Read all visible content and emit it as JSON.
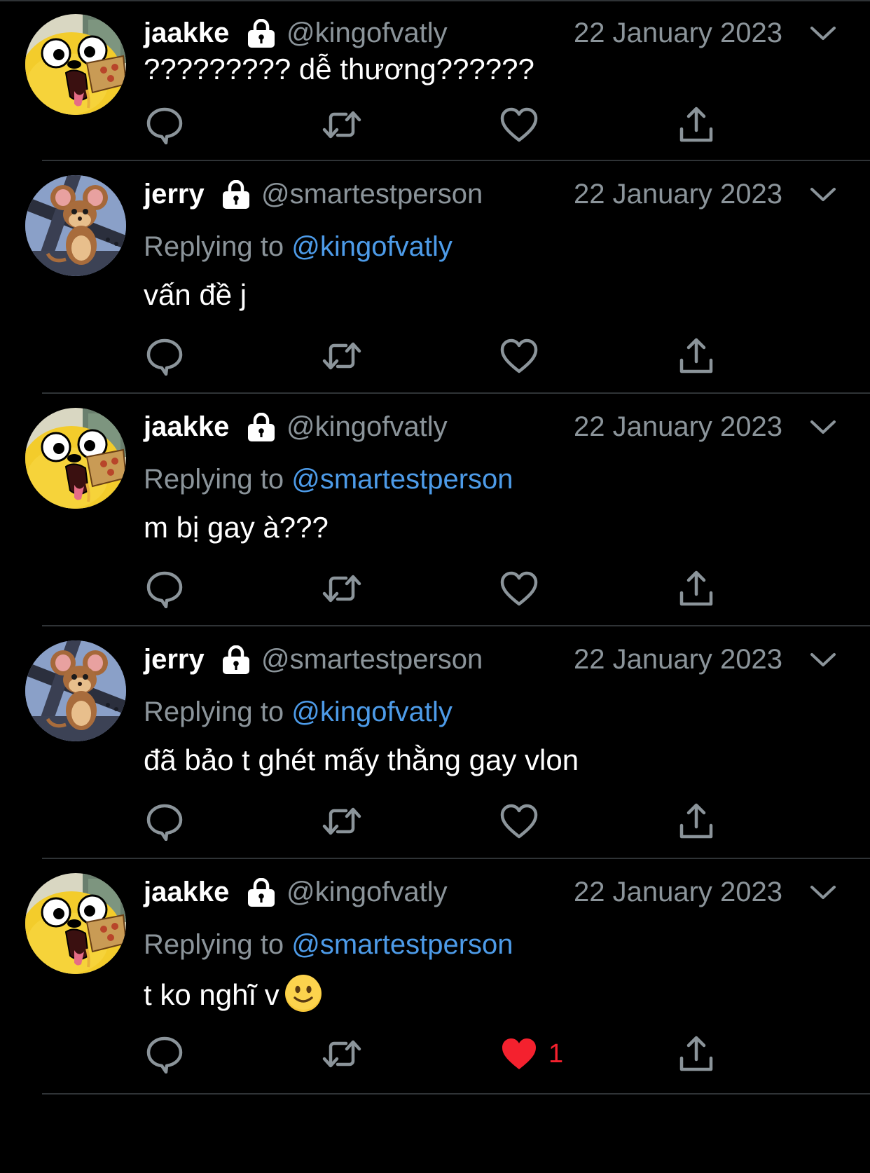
{
  "colors": {
    "background": "#000000",
    "divider": "#2f3336",
    "primary_text": "#ffffff",
    "secondary_text": "#8b949a",
    "mention": "#4d9be8",
    "liked": "#f4212e"
  },
  "tweets": [
    {
      "name": "jaakke",
      "handle": "@kingofvatly",
      "date": "22 January 2023",
      "avatar_icon": "jake-dog-avatar-icon",
      "replying_prefix": "",
      "replying_to": "",
      "text": "????????? dễ thương??????",
      "emoji": "",
      "liked": false,
      "like_count": ""
    },
    {
      "name": "jerry",
      "handle": "@smartestperson",
      "date": "22 January 2023",
      "avatar_icon": "jerry-mouse-avatar-icon",
      "replying_prefix": "Replying to",
      "replying_to": "@kingofvatly",
      "text": "vấn đề j",
      "emoji": "",
      "liked": false,
      "like_count": ""
    },
    {
      "name": "jaakke",
      "handle": "@kingofvatly",
      "date": "22 January 2023",
      "avatar_icon": "jake-dog-avatar-icon",
      "replying_prefix": "Replying to",
      "replying_to": "@smartestperson",
      "text": "m bị gay à???",
      "emoji": "",
      "liked": false,
      "like_count": ""
    },
    {
      "name": "jerry",
      "handle": "@smartestperson",
      "date": "22 January 2023",
      "avatar_icon": "jerry-mouse-avatar-icon",
      "replying_prefix": "Replying to",
      "replying_to": "@kingofvatly",
      "text": "đã bảo t ghét mấy thằng gay vlon",
      "emoji": "",
      "liked": false,
      "like_count": ""
    },
    {
      "name": "jaakke",
      "handle": "@kingofvatly",
      "date": "22 January 2023",
      "avatar_icon": "jake-dog-avatar-icon",
      "replying_prefix": "Replying to",
      "replying_to": "@smartestperson",
      "text": "t ko nghĩ v",
      "emoji": "slightly-smiling-face",
      "liked": true,
      "like_count": "1"
    }
  ]
}
